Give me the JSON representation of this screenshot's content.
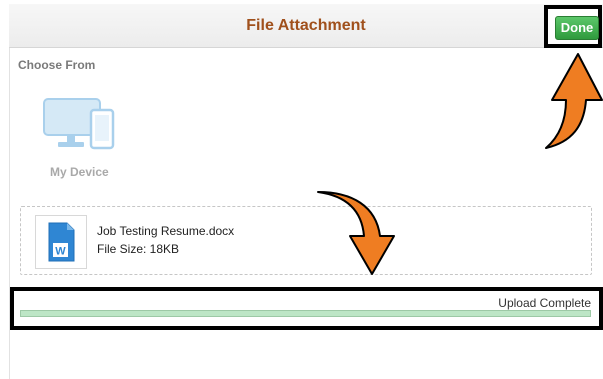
{
  "dialog": {
    "title": "File Attachment",
    "done_label": "Done"
  },
  "choose": {
    "label": "Choose From",
    "source_label": "My Device",
    "source_icon": "device-icon"
  },
  "file": {
    "name": "Job Testing Resume.docx",
    "size": "File Size: 18KB",
    "icon": "word-doc-icon"
  },
  "upload": {
    "status": "Upload Complete",
    "progress_fraction": 1.0
  },
  "colors": {
    "title": "#a0501c",
    "done_button": "#3fae4d",
    "progress_fill": "#bde6c6",
    "arrow": "#ef7d22"
  }
}
